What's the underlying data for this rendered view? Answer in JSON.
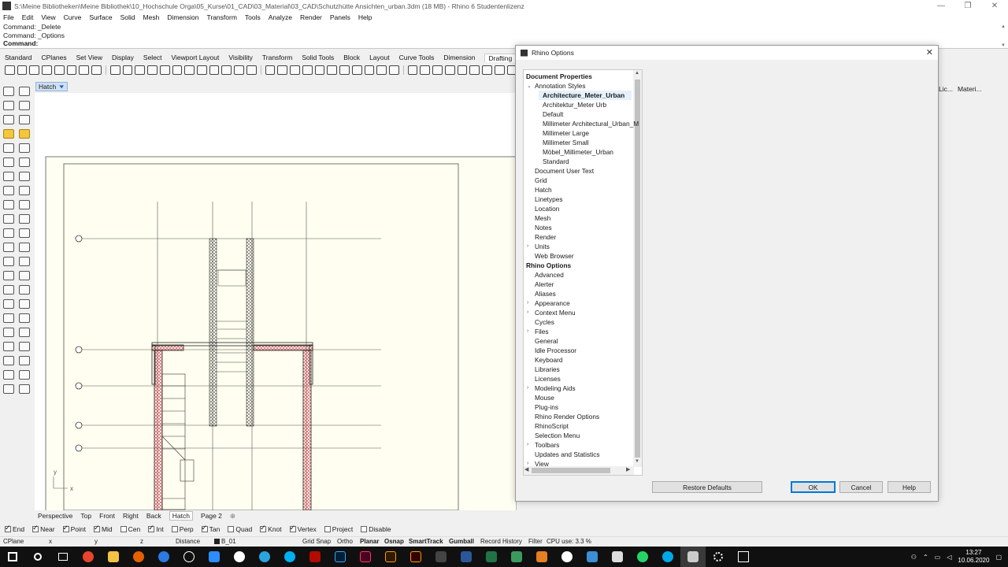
{
  "window": {
    "title": "S:\\Meine Bibliotheken\\Meine Bibliothek\\10_Hochschule Orga\\05_Kurse\\01_CAD\\03_Material\\03_CAD\\Schutzhütte Ansichten_urban.3dm (18 MB) - Rhino 6 Studentenlizenz",
    "minimize": "—",
    "restore": "❐",
    "close": "✕"
  },
  "menu": [
    "File",
    "Edit",
    "View",
    "Curve",
    "Surface",
    "Solid",
    "Mesh",
    "Dimension",
    "Transform",
    "Tools",
    "Analyze",
    "Render",
    "Panels",
    "Help"
  ],
  "command": {
    "history": [
      "Command: _Delete",
      "Command: _Options"
    ],
    "prompt": "Command:"
  },
  "toolbar_tabs": [
    "Standard",
    "CPlanes",
    "Set View",
    "Display",
    "Select",
    "Viewport Layout",
    "Visibility",
    "Transform",
    "Solid Tools",
    "Block",
    "Layout",
    "Curve Tools",
    "Dimension",
    "Drafting"
  ],
  "active_toolbar_tab": "Drafting",
  "viewport": {
    "label": "Hatch",
    "axis_y": "y",
    "axis_x": "x"
  },
  "viewport_tabs": [
    "Perspective",
    "Top",
    "Front",
    "Right",
    "Back",
    "Hatch",
    "Page 2"
  ],
  "active_viewport_tab": "Hatch",
  "viewport_tab_add": "⊕",
  "right_panel": {
    "tab1": "Lic...",
    "tab2": "Materi..."
  },
  "osnap": [
    {
      "label": "End",
      "checked": true
    },
    {
      "label": "Near",
      "checked": true
    },
    {
      "label": "Point",
      "checked": true
    },
    {
      "label": "Mid",
      "checked": true
    },
    {
      "label": "Cen",
      "checked": false
    },
    {
      "label": "Int",
      "checked": true
    },
    {
      "label": "Perp",
      "checked": false
    },
    {
      "label": "Tan",
      "checked": true
    },
    {
      "label": "Quad",
      "checked": false
    },
    {
      "label": "Knot",
      "checked": true
    },
    {
      "label": "Vertex",
      "checked": true
    },
    {
      "label": "Project",
      "checked": false
    },
    {
      "label": "Disable",
      "checked": false
    }
  ],
  "status": {
    "cplane": "CPlane",
    "x": "x",
    "y": "y",
    "z": "z",
    "distance": "Distance",
    "layer": "B_01",
    "grid_snap": "Grid Snap",
    "ortho": "Ortho",
    "planar": "Planar",
    "osnap": "Osnap",
    "smarttrack": "SmartTrack",
    "gumball": "Gumball",
    "record_history": "Record History",
    "filter": "Filter",
    "cpu": "CPU use: 3.3 %"
  },
  "taskbar": {
    "time": "13:27",
    "date": "10.06.2020"
  },
  "dialog": {
    "title": "Rhino Options",
    "close": "✕",
    "tree": {
      "document_properties": "Document Properties",
      "annotation_styles": "Annotation Styles",
      "styles": [
        "Architecture_Meter_Urban",
        "Architektur_Meter Urb",
        "Default",
        "Millimeter Architectural_Urban_M",
        "Millimeter Large",
        "Millimeter Small",
        "Möbel_Millimeter_Urban",
        "Standard"
      ],
      "doc_items": [
        "Document User Text",
        "Grid",
        "Hatch",
        "Linetypes",
        "Location",
        "Mesh",
        "Notes",
        "Render",
        "Units",
        "Web Browser"
      ],
      "rhino_options": "Rhino Options",
      "rhino_items": [
        "Advanced",
        "Alerter",
        "Aliases",
        "Appearance",
        "Context Menu",
        "Cycles",
        "Files",
        "General",
        "Idle Processor",
        "Keyboard",
        "Libraries",
        "Licenses",
        "Modeling Aids",
        "Mouse",
        "Plug-ins",
        "Rhino Render Options",
        "RhinoScript",
        "Selection Menu",
        "Toolbars",
        "Updates and Statistics",
        "View"
      ]
    },
    "buttons": {
      "restore": "Restore Defaults",
      "ok": "OK",
      "cancel": "Cancel",
      "help": "Help"
    }
  },
  "colors": {
    "hatch_red": "#d2384a",
    "selection": "#e5f1fb",
    "accent_blue": "#0078d7"
  }
}
